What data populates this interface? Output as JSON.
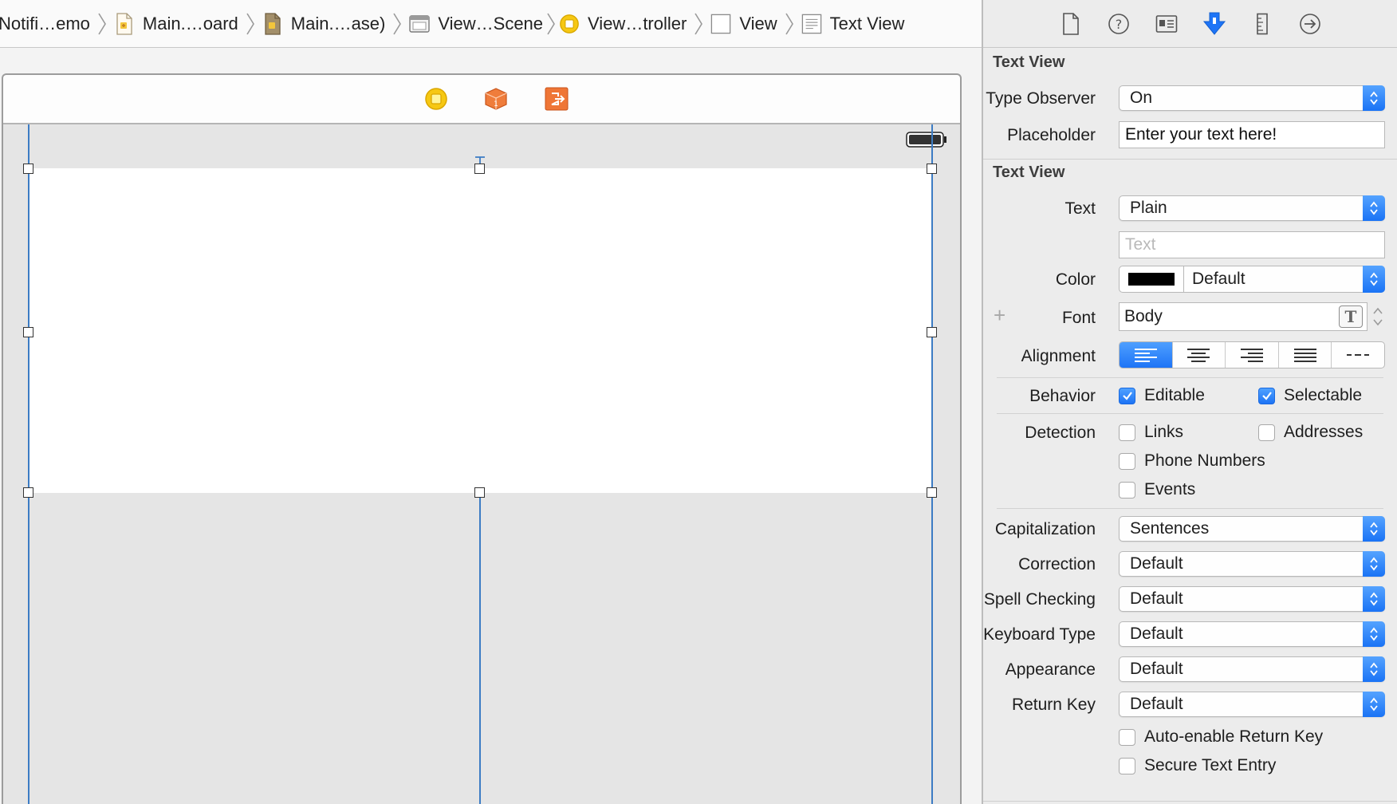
{
  "breadcrumb": [
    {
      "label": "Notifi…emo",
      "icon": "project-icon"
    },
    {
      "label": "Main.…oard",
      "icon": "storyboard-file-icon"
    },
    {
      "label": "Main.…ase)",
      "icon": "storyboard-base-icon"
    },
    {
      "label": "View…Scene",
      "icon": "scene-icon"
    },
    {
      "label": "View…troller",
      "icon": "view-controller-icon"
    },
    {
      "label": "View",
      "icon": "view-icon"
    },
    {
      "label": "Text View",
      "icon": "text-view-icon"
    }
  ],
  "scene_dock": {
    "icons": [
      "view-controller-icon",
      "first-responder-icon",
      "exit-icon"
    ]
  },
  "inspector": {
    "tabs": [
      "file-inspector-icon",
      "quick-help-icon",
      "identity-inspector-icon",
      "attributes-inspector-icon",
      "size-inspector-icon",
      "connections-inspector-icon"
    ],
    "active_tab": "attributes-inspector-icon",
    "custom_section": {
      "title": "Text View",
      "type_observer_label": "Type Observer",
      "type_observer_value": "On",
      "placeholder_label": "Placeholder",
      "placeholder_value": "Enter your text here!"
    },
    "text_view_section": {
      "title": "Text View",
      "text_label": "Text",
      "text_type": "Plain",
      "text_placeholder": "Text",
      "color_label": "Color",
      "color_value": "Default",
      "color_swatch": "#000000",
      "font_label": "Font",
      "font_value": "Body",
      "font_button": "T",
      "alignment_label": "Alignment",
      "alignment_options": [
        "left",
        "center",
        "right",
        "justified",
        "natural"
      ],
      "alignment_selected": "left",
      "behavior_label": "Behavior",
      "behavior": [
        {
          "label": "Editable",
          "checked": true
        },
        {
          "label": "Selectable",
          "checked": true
        }
      ],
      "detection_label": "Detection",
      "detection": [
        {
          "label": "Links",
          "checked": false
        },
        {
          "label": "Addresses",
          "checked": false
        },
        {
          "label": "Phone Numbers",
          "checked": false
        },
        {
          "label": "Events",
          "checked": false
        }
      ],
      "capitalization_label": "Capitalization",
      "capitalization_value": "Sentences",
      "correction_label": "Correction",
      "correction_value": "Default",
      "spell_checking_label": "Spell Checking",
      "spell_checking_value": "Default",
      "keyboard_type_label": "Keyboard Type",
      "keyboard_type_value": "Default",
      "appearance_label": "Appearance",
      "appearance_value": "Default",
      "return_key_label": "Return Key",
      "return_key_value": "Default",
      "auto_enable_return_key": {
        "label": "Auto-enable Return Key",
        "checked": false
      },
      "secure_text_entry": {
        "label": "Secure Text Entry",
        "checked": false
      }
    }
  },
  "colors": {
    "accent": "#1e74f6",
    "constraint_line": "#3c7cc4",
    "canvas_bg": "#e5e5e5",
    "orange_icon": "#f07a3a",
    "yellow_icon": "#f5c400"
  }
}
